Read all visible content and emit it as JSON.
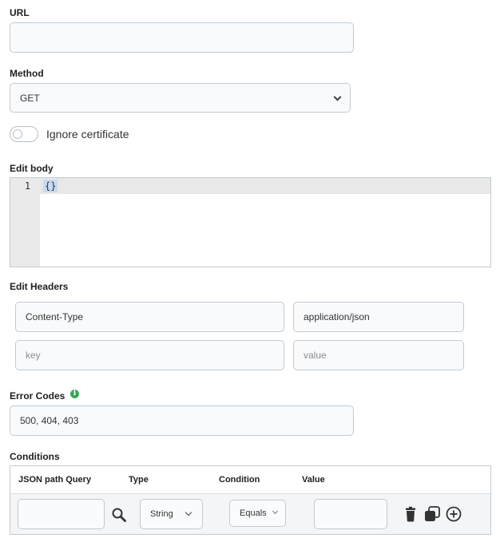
{
  "url": {
    "label": "URL",
    "value": ""
  },
  "method": {
    "label": "Method",
    "value": "GET"
  },
  "ignore_cert": {
    "label": "Ignore certificate",
    "checked": false
  },
  "body": {
    "label": "Edit body",
    "line_number": "1",
    "content": "{}"
  },
  "headers": {
    "label": "Edit Headers",
    "rows": [
      {
        "key": "Content-Type",
        "value": "application/json"
      }
    ],
    "new_row": {
      "key_placeholder": "key",
      "value_placeholder": "value"
    }
  },
  "error_codes": {
    "label": "Error Codes",
    "info_icon": "i",
    "value": "500, 404, 403"
  },
  "conditions": {
    "label": "Conditions",
    "columns": [
      "JSON path Query",
      "Type",
      "Condition",
      "Value"
    ],
    "row": {
      "query": "",
      "type": "String",
      "condition": "Equals",
      "value": ""
    }
  },
  "colors": {
    "info": "#3aa757",
    "border": "#c3cbd3",
    "field_bg": "#f8fafc"
  }
}
